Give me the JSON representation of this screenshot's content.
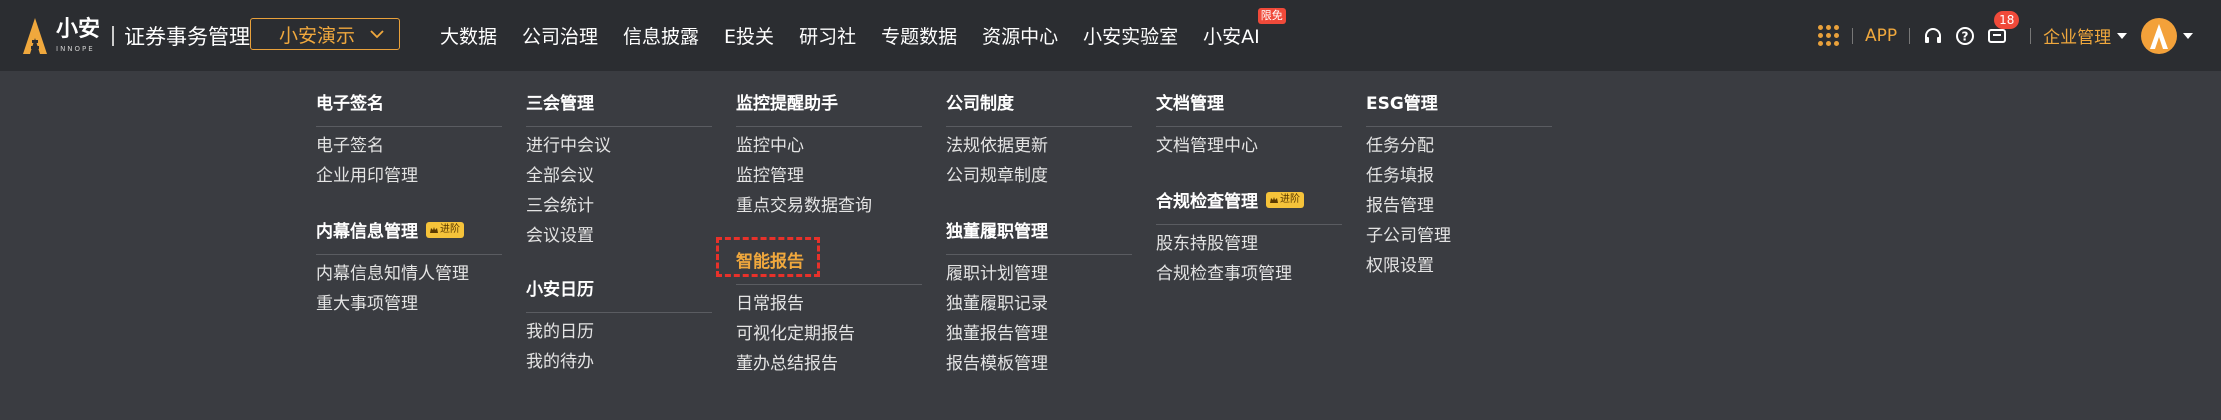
{
  "header": {
    "logo_name": "小安",
    "logo_sub": "INNOPE",
    "app_name": "证券事务管理",
    "demo_select": "小安演示",
    "nav": [
      {
        "label": "大数据"
      },
      {
        "label": "公司治理"
      },
      {
        "label": "信息披露"
      },
      {
        "label": "E投关"
      },
      {
        "label": "研习社"
      },
      {
        "label": "专题数据"
      },
      {
        "label": "资源中心"
      },
      {
        "label": "小安实验室"
      },
      {
        "label": "小安AI",
        "badge": "限免"
      }
    ],
    "app_link": "APP",
    "message_count": "18",
    "enterprise": "企业管理",
    "accent_color": "#f0a83d"
  },
  "menu": {
    "pro_badge": "进阶",
    "columns": [
      {
        "groups": [
          {
            "title": "电子签名",
            "items": [
              "电子签名",
              "企业用印管理"
            ]
          },
          {
            "title": "内幕信息管理",
            "pro": true,
            "items": [
              "内幕信息知情人管理",
              "重大事项管理"
            ]
          }
        ]
      },
      {
        "groups": [
          {
            "title": "三会管理",
            "items": [
              "进行中会议",
              "全部会议",
              "三会统计",
              "会议设置"
            ]
          },
          {
            "title": "小安日历",
            "items": [
              "我的日历",
              "我的待办"
            ]
          }
        ]
      },
      {
        "groups": [
          {
            "title": "监控提醒助手",
            "items": [
              "监控中心",
              "监控管理",
              "重点交易数据查询"
            ]
          },
          {
            "title": "智能报告",
            "highlight": true,
            "items": [
              "日常报告",
              "可视化定期报告",
              "董办总结报告"
            ]
          }
        ]
      },
      {
        "groups": [
          {
            "title": "公司制度",
            "items": [
              "法规依据更新",
              "公司规章制度"
            ]
          },
          {
            "title": "独董履职管理",
            "items": [
              "履职计划管理",
              "独董履职记录",
              "独董报告管理",
              "报告模板管理"
            ]
          }
        ]
      },
      {
        "groups": [
          {
            "title": "文档管理",
            "items": [
              "文档管理中心"
            ]
          },
          {
            "title": "合规检查管理",
            "pro": true,
            "items": [
              "股东持股管理",
              "合规检查事项管理"
            ]
          }
        ]
      },
      {
        "groups": [
          {
            "title": "ESG管理",
            "items": [
              "任务分配",
              "任务填报",
              "报告管理",
              "子公司管理",
              "权限设置"
            ]
          }
        ]
      }
    ]
  }
}
